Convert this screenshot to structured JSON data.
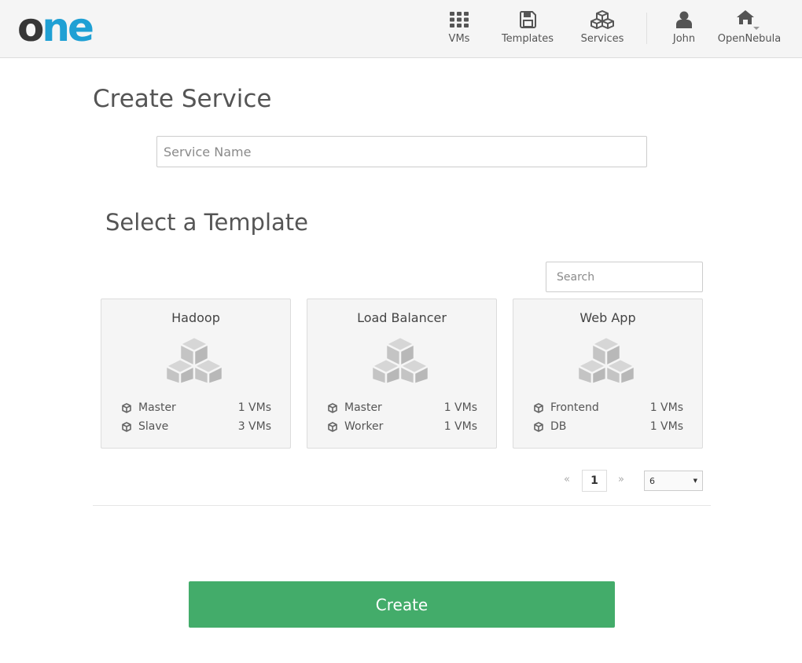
{
  "header": {
    "logo": {
      "part1": "o",
      "part2": "ne"
    },
    "nav": [
      {
        "label": "VMs",
        "icon": "grid-icon"
      },
      {
        "label": "Templates",
        "icon": "floppy-disk-icon"
      },
      {
        "label": "Services",
        "icon": "cubes-icon"
      },
      {
        "label": "John",
        "icon": "user-icon"
      },
      {
        "label": "OpenNebula",
        "icon": "home-icon"
      }
    ]
  },
  "page": {
    "title": "Create Service",
    "service_name_placeholder": "Service Name",
    "section_title": "Select a Template",
    "search_placeholder": "Search"
  },
  "templates": [
    {
      "name": "Hadoop",
      "icon": "cubes-icon",
      "roles": [
        {
          "name": "Master",
          "vms": "1 VMs"
        },
        {
          "name": "Slave",
          "vms": "3 VMs"
        }
      ]
    },
    {
      "name": "Load Balancer",
      "icon": "cubes-icon",
      "roles": [
        {
          "name": "Master",
          "vms": "1 VMs"
        },
        {
          "name": "Worker",
          "vms": "1 VMs"
        }
      ]
    },
    {
      "name": "Web App",
      "icon": "cubes-icon",
      "roles": [
        {
          "name": "Frontend",
          "vms": "1 VMs"
        },
        {
          "name": "DB",
          "vms": "1 VMs"
        }
      ]
    }
  ],
  "pagination": {
    "prev": "«",
    "current": "1",
    "next": "»",
    "page_size": "6"
  },
  "actions": {
    "create_label": "Create"
  },
  "colors": {
    "accent": "#43ac6a",
    "logo_blue": "#1fa0d4",
    "logo_dark": "#363636"
  }
}
